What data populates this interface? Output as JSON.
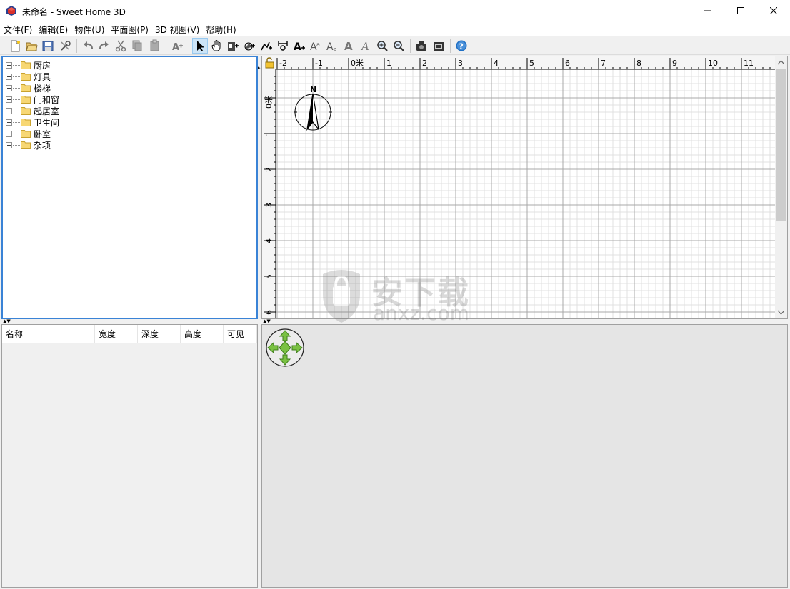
{
  "window": {
    "title": "未命名 - Sweet Home 3D"
  },
  "menu": [
    "文件(F)",
    "编辑(E)",
    "物件(U)",
    "平面图(P)",
    "3D 视图(V)",
    "帮助(H)"
  ],
  "toolbar": {
    "groups": [
      [
        "new-file-icon",
        "open-file-icon",
        "save-file-icon",
        "preferences-icon"
      ],
      [
        "undo-icon",
        "redo-icon",
        "cut-icon",
        "copy-icon",
        "paste-icon"
      ],
      [
        "add-furniture-icon"
      ],
      [
        "select-mode-icon",
        "pan-mode-icon",
        "create-walls-icon",
        "create-rooms-icon",
        "create-polylines-icon",
        "create-dimensions-icon",
        "add-text-icon",
        "increase-text-size-icon",
        "decrease-text-size-icon",
        "bold-text-icon",
        "italic-text-icon",
        "zoom-in-icon",
        "zoom-out-icon"
      ],
      [
        "create-photo-icon",
        "create-video-icon"
      ],
      [
        "help-icon"
      ]
    ],
    "active_tool": "select-mode-icon"
  },
  "catalog": {
    "categories": [
      "厨房",
      "灯具",
      "楼梯",
      "门和窗",
      "起居室",
      "卫生间",
      "卧室",
      "杂项"
    ]
  },
  "furniture_table": {
    "columns": [
      "名称",
      "宽度",
      "深度",
      "高度",
      "可见"
    ]
  },
  "plan": {
    "x_ticks": [
      "-2",
      "-1",
      "0米",
      "1",
      "2",
      "3",
      "4",
      "5",
      "6",
      "7",
      "8",
      "9",
      "10",
      "11"
    ],
    "y_ticks": [
      "0米",
      "1",
      "2",
      "3",
      "4",
      "5",
      "6"
    ],
    "compass_label": "N"
  },
  "watermark": {
    "text": "安下载",
    "sub": "anxz.com"
  }
}
